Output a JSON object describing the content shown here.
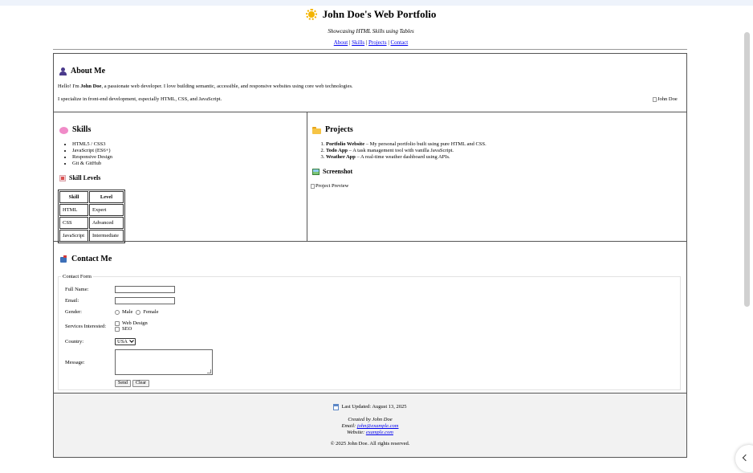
{
  "header": {
    "title": "John Doe's Web Portfolio",
    "title_icon": "sun-icon",
    "subtitle": "Showcasing HTML Skills using Tables",
    "nav": [
      "About",
      "Skills",
      "Projects",
      "Contact"
    ],
    "nav_sep": "|"
  },
  "about": {
    "heading": "About Me",
    "icon": "user-icon",
    "p1_pre": "Hello! I'm ",
    "p1_name": "John Doe",
    "p1_post": ", a passionate web developer. I love building semantic, accessible, and responsive websites using core web technologies.",
    "p2": "I specialize in front-end development, especially HTML, CSS, and JavaScript.",
    "img_alt": "John Doe"
  },
  "skills": {
    "heading": "Skills",
    "icon": "brain-icon",
    "items": [
      "HTML5 / CSS3",
      "JavaScript (ES6+)",
      "Responsive Design",
      "Git & GitHub"
    ],
    "levels_heading": "Skill Levels",
    "levels_icon": "chart-icon",
    "table": {
      "headers": [
        "Skill",
        "Level"
      ],
      "rows": [
        [
          "HTML",
          "Expert"
        ],
        [
          "CSS",
          "Advanced"
        ],
        [
          "JavaScript",
          "Intermediate"
        ]
      ]
    }
  },
  "projects": {
    "heading": "Projects",
    "icon": "folder-icon",
    "items": [
      {
        "name": "Portfolio Website",
        "desc": " – My personal portfolio built using pure HTML and CSS."
      },
      {
        "name": "Todo App",
        "desc": " – A task management tool with vanilla JavaScript."
      },
      {
        "name": "Weather App",
        "desc": " – A real-time weather dashboard using APIs."
      }
    ],
    "screenshot_heading": "Screenshot",
    "screenshot_icon": "picture-icon",
    "img_alt": "Project Preview"
  },
  "contact": {
    "heading": "Contact Me",
    "icon": "mailbox-icon",
    "legend": "Contact Form",
    "labels": {
      "name": "Full Name:",
      "email": "Email:",
      "gender": "Gender:",
      "services": "Services Interested:",
      "country": "Country:",
      "message": "Message:"
    },
    "gender_options": [
      "Male",
      "Female"
    ],
    "service_options": [
      "Web Design",
      "SEO"
    ],
    "country_selected": "USA",
    "buttons": {
      "send": "Send",
      "clear": "Clear"
    }
  },
  "footer": {
    "updated_icon": "calendar-icon",
    "updated": "Last Updated: August 13, 2025",
    "created": "Created by John Doe",
    "email_label": "Email: ",
    "email": "john@example.com",
    "website_label": "Website: ",
    "website": "example.com",
    "copyright": "© 2025 John Doe. All rights reserved."
  },
  "colors": {
    "link": "#0000ee",
    "border": "#555555",
    "footer_bg": "#f2f2f2"
  }
}
